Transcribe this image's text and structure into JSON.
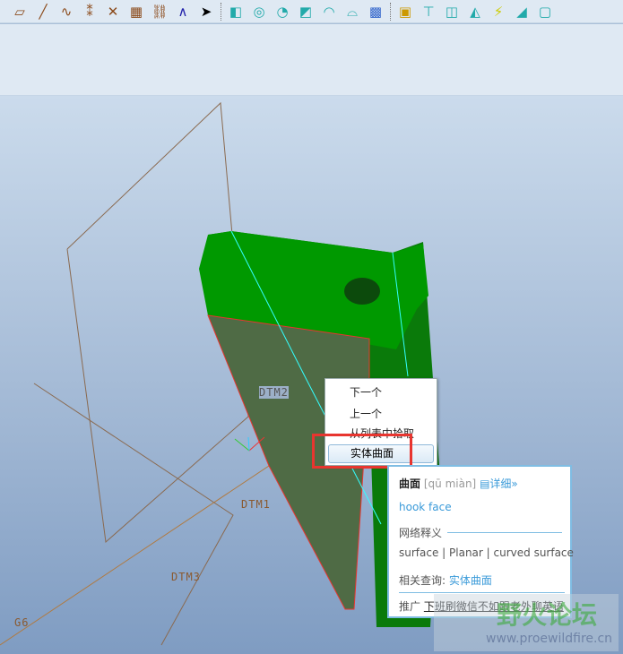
{
  "toolbar": {
    "icons": [
      "datum-plane-icon",
      "datum-axis-icon",
      "sketch-curve-icon",
      "datum-point-icon",
      "coordinate-system-icon",
      "analysis-icon",
      "chain-icon",
      "csys-icon",
      "select-icon",
      "extrude-icon",
      "revolve-icon",
      "sweep-icon",
      "blend-icon",
      "boundary-icon",
      "style-icon",
      "warp-icon",
      "hole-icon",
      "cut-icon",
      "shell-icon",
      "rib-icon",
      "draft-icon",
      "round-icon",
      "chamfer-icon"
    ]
  },
  "datums": {
    "dtm2": "DTM2",
    "dtm1": "DTM1",
    "dtm3": "DTM3",
    "g6": "G6"
  },
  "context_menu": {
    "items": [
      "下一个",
      "上一个",
      "从列表中拾取"
    ],
    "selected": "实体曲面"
  },
  "dictionary": {
    "word": "曲面",
    "pinyin": "[qū miàn]",
    "detail": "详细»",
    "translation": "hook face",
    "web_section": "网络释义",
    "web_meanings": "surface | Planar | curved surface",
    "related_label": "相关查询:",
    "related_link": "实体曲面",
    "promo_label": "推广",
    "promo_link": "下班刷微信不如跟老外聊英语"
  },
  "watermark": {
    "title": "野火论坛",
    "url": "www.proewildfire.cn"
  },
  "colors": {
    "model_green": "#009900",
    "face_olive": "#4f6b45",
    "highlight_red": "#e8352f",
    "link_blue": "#3a9ad9"
  }
}
